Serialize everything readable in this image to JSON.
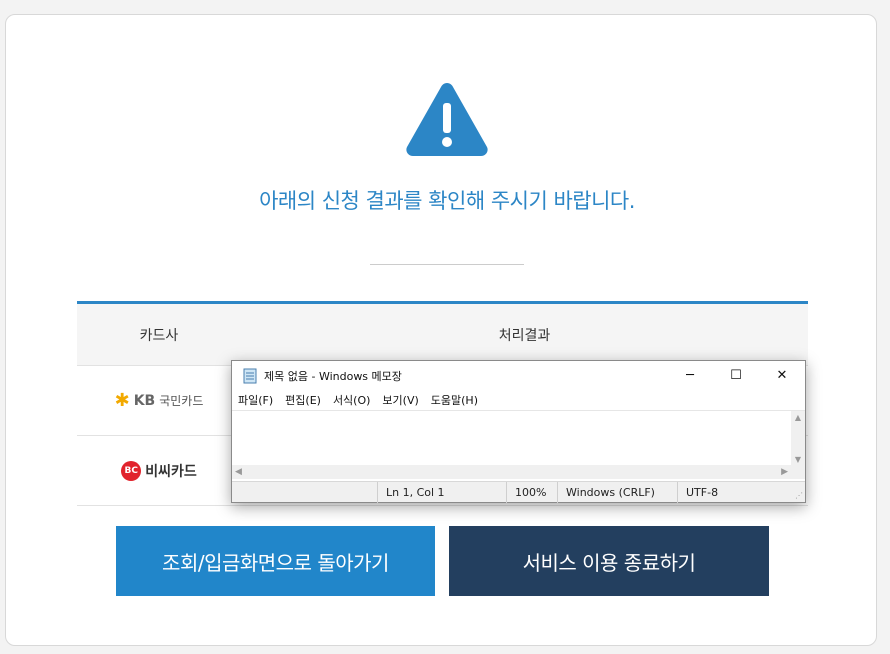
{
  "headline": "아래의 신청 결과를 확인해 주시기 바랍니다.",
  "table": {
    "col_card": "카드사",
    "col_result": "처리결과",
    "rows": [
      {
        "card_name": "KB국민카드",
        "card_mark": "KB",
        "card_text": "국민카드"
      },
      {
        "card_name": "비씨카드",
        "card_mark": "BC",
        "card_text": "비씨카드"
      }
    ]
  },
  "buttons": {
    "back": "조회/입금화면으로 돌아가기",
    "end": "서비스 이용 종료하기"
  },
  "notepad": {
    "title": "제목 없음 - Windows 메모장",
    "menu": [
      "파일(F)",
      "편집(E)",
      "서식(O)",
      "보기(V)",
      "도움말(H)"
    ],
    "status": {
      "position": "Ln 1, Col 1",
      "zoom": "100%",
      "line_ending": "Windows (CRLF)",
      "encoding": "UTF-8"
    }
  },
  "colors": {
    "accent": "#2c86c6",
    "back_button": "#2186ca",
    "end_button": "#233f5f"
  }
}
